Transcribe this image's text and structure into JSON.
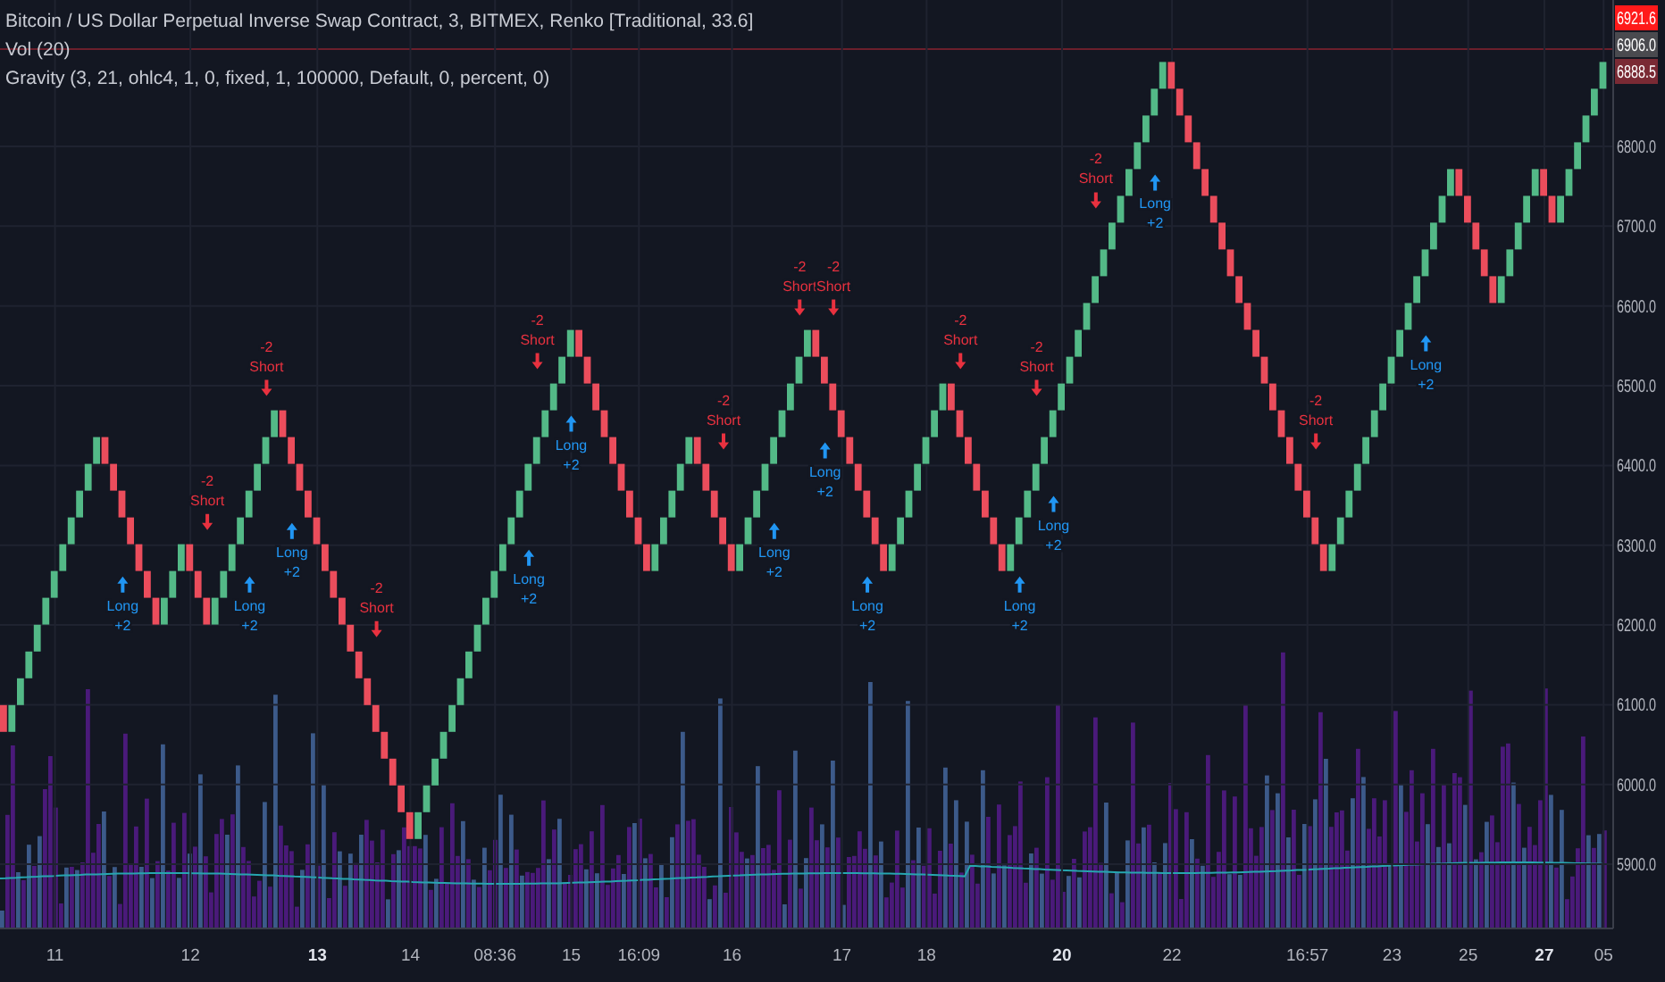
{
  "legend": [
    {
      "text": "Bitcoin / US Dollar Perpetual Inverse Swap Contract, 3, BITMEX, Renko [Traditional, 33.6]"
    },
    {
      "text": "Vol (20)"
    },
    {
      "text": "Gravity (3, 21, ohlc4, 1, 0, fixed, 1, 100000, Default, 0, percent, 0)"
    }
  ],
  "price_tags": [
    {
      "text": "6921.6",
      "color": "#ff1a1a"
    },
    {
      "text": "6906.0",
      "color": "#4a4a4f"
    },
    {
      "text": "6888.5",
      "color": "#7a2a34"
    }
  ],
  "chart_data": {
    "type": "candlestick",
    "ylim": [
      5819.5,
      6983.6
    ],
    "grid": true,
    "yticks": [
      {
        "value": 6800,
        "label": "6800.0"
      },
      {
        "value": 6700,
        "label": "6700.0"
      },
      {
        "value": 6600,
        "label": "6600.0"
      },
      {
        "value": 6500,
        "label": "6500.0"
      },
      {
        "value": 6400,
        "label": "6400.0"
      },
      {
        "value": 6300,
        "label": "6300.0"
      },
      {
        "value": 6200,
        "label": "6200.0"
      },
      {
        "value": 6100,
        "label": "6100.0"
      },
      {
        "value": 6000,
        "label": "6000.0"
      },
      {
        "value": 5900,
        "label": "5900.0"
      }
    ],
    "categories": [
      null,
      null,
      null,
      null,
      null,
      null,
      "11",
      null,
      null,
      null,
      null,
      null,
      null,
      null,
      null,
      null,
      null,
      null,
      null,
      null,
      null,
      null,
      "12",
      null,
      null,
      null,
      null,
      null,
      null,
      null,
      null,
      null,
      null,
      null,
      null,
      null,
      null,
      "13",
      null,
      null,
      null,
      null,
      null,
      null,
      null,
      null,
      null,
      null,
      "14",
      null,
      null,
      null,
      null,
      null,
      null,
      null,
      null,
      null,
      "08:36",
      null,
      null,
      null,
      null,
      null,
      null,
      null,
      null,
      "15",
      null,
      null,
      null,
      null,
      null,
      null,
      null,
      "16:09",
      null,
      null,
      null,
      null,
      null,
      null,
      null,
      null,
      null,
      null,
      "16",
      null,
      null,
      null,
      null,
      null,
      null,
      null,
      null,
      null,
      null,
      null,
      null,
      "17",
      null,
      null,
      null,
      null,
      null,
      null,
      null,
      null,
      null,
      "18",
      null,
      null,
      null,
      null,
      null,
      null,
      null,
      null,
      null,
      null,
      null,
      null,
      null,
      null,
      null,
      "20",
      null,
      null,
      null,
      null,
      null,
      null,
      null,
      null,
      null,
      null,
      null,
      null,
      "22",
      null,
      null,
      null,
      null,
      null,
      null,
      null,
      null,
      null,
      null,
      null,
      null,
      null,
      null,
      null,
      "16:57",
      null,
      null,
      null,
      null,
      null,
      null,
      null,
      null,
      null,
      "23",
      null,
      null,
      null,
      null,
      null,
      null,
      null,
      null,
      "25",
      null,
      null,
      null,
      null,
      null,
      null,
      null,
      null,
      "27",
      null,
      null,
      null,
      null,
      null,
      null,
      "05"
    ],
    "ohlc": [
      [
        6099.6,
        6099.6,
        6066,
        6066
      ],
      [
        6066,
        6099.6,
        6066,
        6099.6
      ],
      [
        6099.6,
        6133.2,
        6099.6,
        6133.2
      ],
      [
        6133.2,
        6166.8,
        6133.2,
        6166.8
      ],
      [
        6166.8,
        6200.4,
        6166.8,
        6200.4
      ],
      [
        6200.4,
        6234,
        6200.4,
        6234
      ],
      [
        6234,
        6267.6,
        6234,
        6267.6
      ],
      [
        6267.6,
        6301.2,
        6267.6,
        6301.2
      ],
      [
        6301.2,
        6334.8,
        6301.2,
        6334.8
      ],
      [
        6334.8,
        6368.4,
        6334.8,
        6368.4
      ],
      [
        6368.4,
        6402,
        6368.4,
        6402
      ],
      [
        6402,
        6435.6,
        6402,
        6435.6
      ],
      [
        6435.6,
        6435.6,
        6402,
        6402
      ],
      [
        6402,
        6402,
        6368.4,
        6368.4
      ],
      [
        6368.4,
        6368.4,
        6334.8,
        6334.8
      ],
      [
        6334.8,
        6334.8,
        6301.2,
        6301.2
      ],
      [
        6301.2,
        6301.2,
        6267.6,
        6267.6
      ],
      [
        6267.6,
        6267.6,
        6234,
        6234
      ],
      [
        6234,
        6234,
        6200.4,
        6200.4
      ],
      [
        6200.4,
        6234,
        6200.4,
        6234
      ],
      [
        6234,
        6267.6,
        6234,
        6267.6
      ],
      [
        6267.6,
        6301.2,
        6267.6,
        6301.2
      ],
      [
        6301.2,
        6301.2,
        6267.6,
        6267.6
      ],
      [
        6267.6,
        6267.6,
        6234,
        6234
      ],
      [
        6234,
        6234,
        6200.4,
        6200.4
      ],
      [
        6200.4,
        6234,
        6200.4,
        6234
      ],
      [
        6234,
        6267.6,
        6234,
        6267.6
      ],
      [
        6267.6,
        6301.2,
        6267.6,
        6301.2
      ],
      [
        6301.2,
        6334.8,
        6301.2,
        6334.8
      ],
      [
        6334.8,
        6368.4,
        6334.8,
        6368.4
      ],
      [
        6368.4,
        6402,
        6368.4,
        6402
      ],
      [
        6402,
        6435.6,
        6402,
        6435.6
      ],
      [
        6435.6,
        6469.2,
        6435.6,
        6469.2
      ],
      [
        6469.2,
        6469.2,
        6435.6,
        6435.6
      ],
      [
        6435.6,
        6435.6,
        6402,
        6402
      ],
      [
        6402,
        6402,
        6368.4,
        6368.4
      ],
      [
        6368.4,
        6368.4,
        6334.8,
        6334.8
      ],
      [
        6334.8,
        6334.8,
        6301.2,
        6301.2
      ],
      [
        6301.2,
        6301.2,
        6267.6,
        6267.6
      ],
      [
        6267.6,
        6267.6,
        6234,
        6234
      ],
      [
        6234,
        6234,
        6200.4,
        6200.4
      ],
      [
        6200.4,
        6200.4,
        6166.8,
        6166.8
      ],
      [
        6166.8,
        6166.8,
        6133.2,
        6133.2
      ],
      [
        6133.2,
        6133.2,
        6099.6,
        6099.6
      ],
      [
        6099.6,
        6099.6,
        6066,
        6066
      ],
      [
        6066,
        6066,
        6032.4,
        6032.4
      ],
      [
        6032.4,
        6032.4,
        5998.8,
        5998.8
      ],
      [
        5998.8,
        5998.8,
        5965.2,
        5965.2
      ],
      [
        5965.2,
        5965.2,
        5931.6,
        5931.6
      ],
      [
        5931.6,
        5965.2,
        5931.6,
        5965.2
      ],
      [
        5965.2,
        5998.8,
        5965.2,
        5998.8
      ],
      [
        5998.8,
        6032.4,
        5998.8,
        6032.4
      ],
      [
        6032.4,
        6066,
        6032.4,
        6066
      ],
      [
        6066,
        6099.6,
        6066,
        6099.6
      ],
      [
        6099.6,
        6133.2,
        6099.6,
        6133.2
      ],
      [
        6133.2,
        6166.8,
        6133.2,
        6166.8
      ],
      [
        6166.8,
        6200.4,
        6166.8,
        6200.4
      ],
      [
        6200.4,
        6234,
        6200.4,
        6234
      ],
      [
        6234,
        6267.6,
        6234,
        6267.6
      ],
      [
        6267.6,
        6301.2,
        6267.6,
        6301.2
      ],
      [
        6301.2,
        6334.8,
        6301.2,
        6334.8
      ],
      [
        6334.8,
        6368.4,
        6334.8,
        6368.4
      ],
      [
        6368.4,
        6402,
        6368.4,
        6402
      ],
      [
        6402,
        6435.6,
        6402,
        6435.6
      ],
      [
        6435.6,
        6469.2,
        6435.6,
        6469.2
      ],
      [
        6469.2,
        6502.8,
        6469.2,
        6502.8
      ],
      [
        6502.8,
        6536.4,
        6502.8,
        6536.4
      ],
      [
        6536.4,
        6570,
        6536.4,
        6570
      ],
      [
        6570,
        6570,
        6536.4,
        6536.4
      ],
      [
        6536.4,
        6536.4,
        6502.8,
        6502.8
      ],
      [
        6502.8,
        6502.8,
        6469.2,
        6469.2
      ],
      [
        6469.2,
        6469.2,
        6435.6,
        6435.6
      ],
      [
        6435.6,
        6435.6,
        6402,
        6402
      ],
      [
        6402,
        6402,
        6368.4,
        6368.4
      ],
      [
        6368.4,
        6368.4,
        6334.8,
        6334.8
      ],
      [
        6334.8,
        6334.8,
        6301.2,
        6301.2
      ],
      [
        6301.2,
        6301.2,
        6267.6,
        6267.6
      ],
      [
        6267.6,
        6301.2,
        6267.6,
        6301.2
      ],
      [
        6301.2,
        6334.8,
        6301.2,
        6334.8
      ],
      [
        6334.8,
        6368.4,
        6334.8,
        6368.4
      ],
      [
        6368.4,
        6402,
        6368.4,
        6402
      ],
      [
        6402,
        6435.6,
        6402,
        6435.6
      ],
      [
        6435.6,
        6435.6,
        6402,
        6402
      ],
      [
        6402,
        6402,
        6368.4,
        6368.4
      ],
      [
        6368.4,
        6368.4,
        6334.8,
        6334.8
      ],
      [
        6334.8,
        6334.8,
        6301.2,
        6301.2
      ],
      [
        6301.2,
        6301.2,
        6267.6,
        6267.6
      ],
      [
        6267.6,
        6301.2,
        6267.6,
        6301.2
      ],
      [
        6301.2,
        6334.8,
        6301.2,
        6334.8
      ],
      [
        6334.8,
        6368.4,
        6334.8,
        6368.4
      ],
      [
        6368.4,
        6402,
        6368.4,
        6402
      ],
      [
        6402,
        6435.6,
        6402,
        6435.6
      ],
      [
        6435.6,
        6469.2,
        6435.6,
        6469.2
      ],
      [
        6469.2,
        6502.8,
        6469.2,
        6502.8
      ],
      [
        6502.8,
        6536.4,
        6502.8,
        6536.4
      ],
      [
        6536.4,
        6570,
        6536.4,
        6570
      ],
      [
        6570,
        6570,
        6536.4,
        6536.4
      ],
      [
        6536.4,
        6536.4,
        6502.8,
        6502.8
      ],
      [
        6502.8,
        6502.8,
        6469.2,
        6469.2
      ],
      [
        6469.2,
        6469.2,
        6435.6,
        6435.6
      ],
      [
        6435.6,
        6435.6,
        6402,
        6402
      ],
      [
        6402,
        6402,
        6368.4,
        6368.4
      ],
      [
        6368.4,
        6368.4,
        6334.8,
        6334.8
      ],
      [
        6334.8,
        6334.8,
        6301.2,
        6301.2
      ],
      [
        6301.2,
        6301.2,
        6267.6,
        6267.6
      ],
      [
        6267.6,
        6301.2,
        6267.6,
        6301.2
      ],
      [
        6301.2,
        6334.8,
        6301.2,
        6334.8
      ],
      [
        6334.8,
        6368.4,
        6334.8,
        6368.4
      ],
      [
        6368.4,
        6402,
        6368.4,
        6402
      ],
      [
        6402,
        6435.6,
        6402,
        6435.6
      ],
      [
        6435.6,
        6469.2,
        6435.6,
        6469.2
      ],
      [
        6469.2,
        6502.8,
        6469.2,
        6502.8
      ],
      [
        6502.8,
        6502.8,
        6469.2,
        6469.2
      ],
      [
        6469.2,
        6469.2,
        6435.6,
        6435.6
      ],
      [
        6435.6,
        6435.6,
        6402,
        6402
      ],
      [
        6402,
        6402,
        6368.4,
        6368.4
      ],
      [
        6368.4,
        6368.4,
        6334.8,
        6334.8
      ],
      [
        6334.8,
        6334.8,
        6301.2,
        6301.2
      ],
      [
        6301.2,
        6301.2,
        6267.6,
        6267.6
      ],
      [
        6267.6,
        6301.2,
        6267.6,
        6301.2
      ],
      [
        6301.2,
        6334.8,
        6301.2,
        6334.8
      ],
      [
        6334.8,
        6368.4,
        6334.8,
        6368.4
      ],
      [
        6368.4,
        6402,
        6368.4,
        6402
      ],
      [
        6402,
        6435.6,
        6402,
        6435.6
      ],
      [
        6435.6,
        6469.2,
        6435.6,
        6469.2
      ],
      [
        6469.2,
        6502.8,
        6469.2,
        6502.8
      ],
      [
        6502.8,
        6536.4,
        6502.8,
        6536.4
      ],
      [
        6536.4,
        6570,
        6536.4,
        6570
      ],
      [
        6570,
        6603.6,
        6570,
        6603.6
      ],
      [
        6603.6,
        6637.2,
        6603.6,
        6637.2
      ],
      [
        6637.2,
        6670.8,
        6637.2,
        6670.8
      ],
      [
        6670.8,
        6704.4,
        6670.8,
        6704.4
      ],
      [
        6704.4,
        6738,
        6704.4,
        6738
      ],
      [
        6738,
        6771.6,
        6738,
        6771.6
      ],
      [
        6771.6,
        6805.2,
        6771.6,
        6805.2
      ],
      [
        6805.2,
        6838.8,
        6805.2,
        6838.8
      ],
      [
        6838.8,
        6872.4,
        6838.8,
        6872.4
      ],
      [
        6872.4,
        6906,
        6872.4,
        6906
      ],
      [
        6906,
        6906,
        6872.4,
        6872.4
      ],
      [
        6872.4,
        6872.4,
        6838.8,
        6838.8
      ],
      [
        6838.8,
        6838.8,
        6805.2,
        6805.2
      ],
      [
        6805.2,
        6805.2,
        6771.6,
        6771.6
      ],
      [
        6771.6,
        6771.6,
        6738,
        6738
      ],
      [
        6738,
        6738,
        6704.4,
        6704.4
      ],
      [
        6704.4,
        6704.4,
        6670.8,
        6670.8
      ],
      [
        6670.8,
        6670.8,
        6637.2,
        6637.2
      ],
      [
        6637.2,
        6637.2,
        6603.6,
        6603.6
      ],
      [
        6603.6,
        6603.6,
        6570,
        6570
      ],
      [
        6570,
        6570,
        6536.4,
        6536.4
      ],
      [
        6536.4,
        6536.4,
        6502.8,
        6502.8
      ],
      [
        6502.8,
        6502.8,
        6469.2,
        6469.2
      ],
      [
        6469.2,
        6469.2,
        6435.6,
        6435.6
      ],
      [
        6435.6,
        6435.6,
        6402,
        6402
      ],
      [
        6402,
        6402,
        6368.4,
        6368.4
      ],
      [
        6368.4,
        6368.4,
        6334.8,
        6334.8
      ],
      [
        6334.8,
        6334.8,
        6301.2,
        6301.2
      ],
      [
        6301.2,
        6301.2,
        6267.6,
        6267.6
      ],
      [
        6267.6,
        6301.2,
        6267.6,
        6301.2
      ],
      [
        6301.2,
        6334.8,
        6301.2,
        6334.8
      ],
      [
        6334.8,
        6368.4,
        6334.8,
        6368.4
      ],
      [
        6368.4,
        6402,
        6368.4,
        6402
      ],
      [
        6402,
        6435.6,
        6402,
        6435.6
      ],
      [
        6435.6,
        6469.2,
        6435.6,
        6469.2
      ],
      [
        6469.2,
        6502.8,
        6469.2,
        6502.8
      ],
      [
        6502.8,
        6536.4,
        6502.8,
        6536.4
      ],
      [
        6536.4,
        6570,
        6536.4,
        6570
      ],
      [
        6570,
        6603.6,
        6570,
        6603.6
      ],
      [
        6603.6,
        6637.2,
        6603.6,
        6637.2
      ],
      [
        6637.2,
        6670.8,
        6637.2,
        6670.8
      ],
      [
        6670.8,
        6704.4,
        6670.8,
        6704.4
      ],
      [
        6704.4,
        6738,
        6704.4,
        6738
      ],
      [
        6738,
        6771.6,
        6738,
        6771.6
      ],
      [
        6771.6,
        6771.6,
        6738,
        6738
      ],
      [
        6738,
        6738,
        6704.4,
        6704.4
      ],
      [
        6704.4,
        6704.4,
        6670.8,
        6670.8
      ],
      [
        6670.8,
        6670.8,
        6637.2,
        6637.2
      ],
      [
        6637.2,
        6637.2,
        6603.6,
        6603.6
      ],
      [
        6603.6,
        6637.2,
        6603.6,
        6637.2
      ],
      [
        6637.2,
        6670.8,
        6637.2,
        6670.8
      ],
      [
        6670.8,
        6704.4,
        6670.8,
        6704.4
      ],
      [
        6704.4,
        6738,
        6704.4,
        6738
      ],
      [
        6738,
        6771.6,
        6738,
        6771.6
      ],
      [
        6771.6,
        6771.6,
        6738,
        6738
      ],
      [
        6738,
        6738,
        6704.4,
        6704.4
      ],
      [
        6704.4,
        6738,
        6704.4,
        6738
      ],
      [
        6738,
        6771.6,
        6738,
        6771.6
      ],
      [
        6771.6,
        6805.2,
        6771.6,
        6805.2
      ],
      [
        6805.2,
        6838.8,
        6805.2,
        6838.8
      ],
      [
        6838.8,
        6872.4,
        6838.8,
        6872.4
      ],
      [
        6872.4,
        6906,
        6872.4,
        6906
      ]
    ]
  },
  "time_axis": [
    {
      "bold": false
    },
    {
      "bold": false
    },
    {
      "bold": true
    },
    {
      "bold": false
    },
    {
      "bold": false
    },
    {
      "bold": false
    },
    {
      "bold": false
    },
    {
      "bold": false
    },
    {
      "bold": false
    },
    {
      "bold": false
    },
    {
      "bold": true
    },
    {
      "bold": false
    },
    {
      "bold": false
    },
    {
      "bold": false
    },
    {
      "bold": false
    },
    {
      "bold": true
    },
    {
      "bold": false
    }
  ],
  "signals": [
    {
      "kind": "long",
      "text": "Long",
      "amount": "+2"
    },
    {
      "kind": "short",
      "text": "Short",
      "amount": "-2"
    },
    {
      "kind": "long",
      "text": "Long",
      "amount": "+2"
    },
    {
      "kind": "short",
      "text": "Short",
      "amount": "-2"
    },
    {
      "kind": "long",
      "text": "Long",
      "amount": "+2"
    },
    {
      "kind": "short",
      "text": "Short",
      "amount": "-2"
    },
    {
      "kind": "long",
      "text": "Long",
      "amount": "+2"
    },
    {
      "kind": "short",
      "text": "Short",
      "amount": "-2"
    },
    {
      "kind": "long",
      "text": "Long",
      "amount": "+2"
    },
    {
      "kind": "short",
      "text": "Short",
      "amount": "-2"
    },
    {
      "kind": "long",
      "text": "Long",
      "amount": "+2"
    },
    {
      "kind": "short",
      "text": "Short",
      "amount": "-2"
    },
    {
      "kind": "long",
      "text": "Long",
      "amount": "+2"
    },
    {
      "kind": "short",
      "text": "Short",
      "amount": "-2"
    },
    {
      "kind": "long",
      "text": "Long",
      "amount": "+2"
    },
    {
      "kind": "short",
      "text": "Short",
      "amount": "-2"
    },
    {
      "kind": "long",
      "text": "Long",
      "amount": "+2"
    },
    {
      "kind": "short",
      "text": "Short",
      "amount": "-2"
    },
    {
      "kind": "long",
      "text": "Long",
      "amount": "+2"
    },
    {
      "kind": "short",
      "text": "Short",
      "amount": "-2"
    },
    {
      "kind": "long",
      "text": "Long",
      "amount": "+2"
    },
    {
      "kind": "short",
      "text": "Short",
      "amount": "-2"
    },
    {
      "kind": "long",
      "text": "Long",
      "amount": "+2"
    }
  ]
}
